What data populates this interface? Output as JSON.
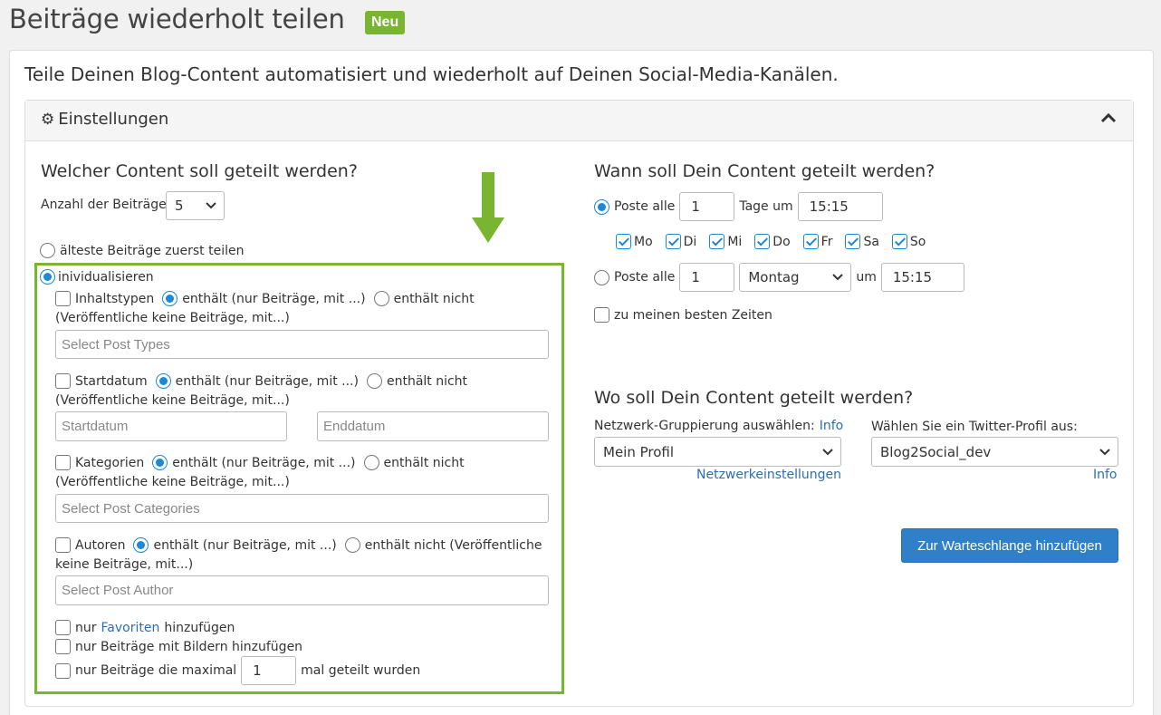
{
  "header": {
    "title": "Beiträge wiederholt teilen",
    "badge": "Neu"
  },
  "subtitle": "Teile Deinen Blog-Content automatisiert und wiederholt auf Deinen Social-Media-Kanälen.",
  "panel": {
    "title": "Einstellungen"
  },
  "left": {
    "heading": "Welcher Content soll geteilt werden?",
    "count_label": "Anzahl der Beiträge",
    "count_value": "5",
    "oldest_label": "älteste Beiträge zuerst teilen",
    "custom_label": "inividualisieren",
    "post_types": {
      "label": "Inhaltstypen",
      "contains": "enthält (nur Beiträge, mit ...)",
      "not": "enthält nicht",
      "note": "(Veröffentliche keine Beiträge, mit...)",
      "placeholder": "Select Post Types"
    },
    "start_date": {
      "label": "Startdatum",
      "contains": "enthält (nur Beiträge, mit ...)",
      "not": "enthält nicht",
      "note": "(Veröffentliche keine Beiträge, mit...)",
      "from_placeholder": "Startdatum",
      "to_placeholder": "Enddatum"
    },
    "categories": {
      "label": "Kategorien",
      "contains": "enthält (nur Beiträge, mit ...)",
      "not": "enthält nicht",
      "note": "(Veröffentliche keine Beiträge, mit...)",
      "placeholder": "Select Post Categories"
    },
    "authors": {
      "label": "Autoren",
      "contains": "enthält (nur Beiträge, mit ...)",
      "not": "enthält nicht (Veröffentliche",
      "note": "keine Beiträge, mit...)",
      "placeholder": "Select Post Author"
    },
    "favorites": {
      "pre": "nur",
      "link": "Favoriten",
      "post": "hinzufügen"
    },
    "images_label": "nur Beiträge mit Bildern hinzufügen",
    "max_shared": {
      "pre": "nur Beiträge die maximal",
      "value": "1",
      "post": "mal geteilt wurden"
    }
  },
  "right": {
    "when_heading": "Wann soll Dein Content geteilt werden?",
    "daily": {
      "label": "Poste alle",
      "value": "1",
      "unit": "Tage um",
      "time": "15:15"
    },
    "days": [
      "Mo",
      "Di",
      "Mi",
      "Do",
      "Fr",
      "Sa",
      "So"
    ],
    "weekly": {
      "label": "Poste alle",
      "value": "1",
      "weekday": "Montag",
      "at": "um",
      "time": "15:15"
    },
    "best_times_label": "zu meinen besten Zeiten",
    "where_heading": "Wo soll Dein Content geteilt werden?",
    "network_label": "Netzwerk-Gruppierung auswählen:",
    "network_info": "Info",
    "network_value": "Mein Profil",
    "network_settings": "Netzwerkeinstellungen",
    "twitter_label": "Wählen Sie ein Twitter-Profil aus:",
    "twitter_value": "Blog2Social_dev",
    "twitter_info": "Info",
    "submit": "Zur Warteschlange hinzufügen"
  },
  "colors": {
    "accent_green": "#79b530",
    "primary_blue": "#2f80c8",
    "link": "#2a6fb0"
  }
}
